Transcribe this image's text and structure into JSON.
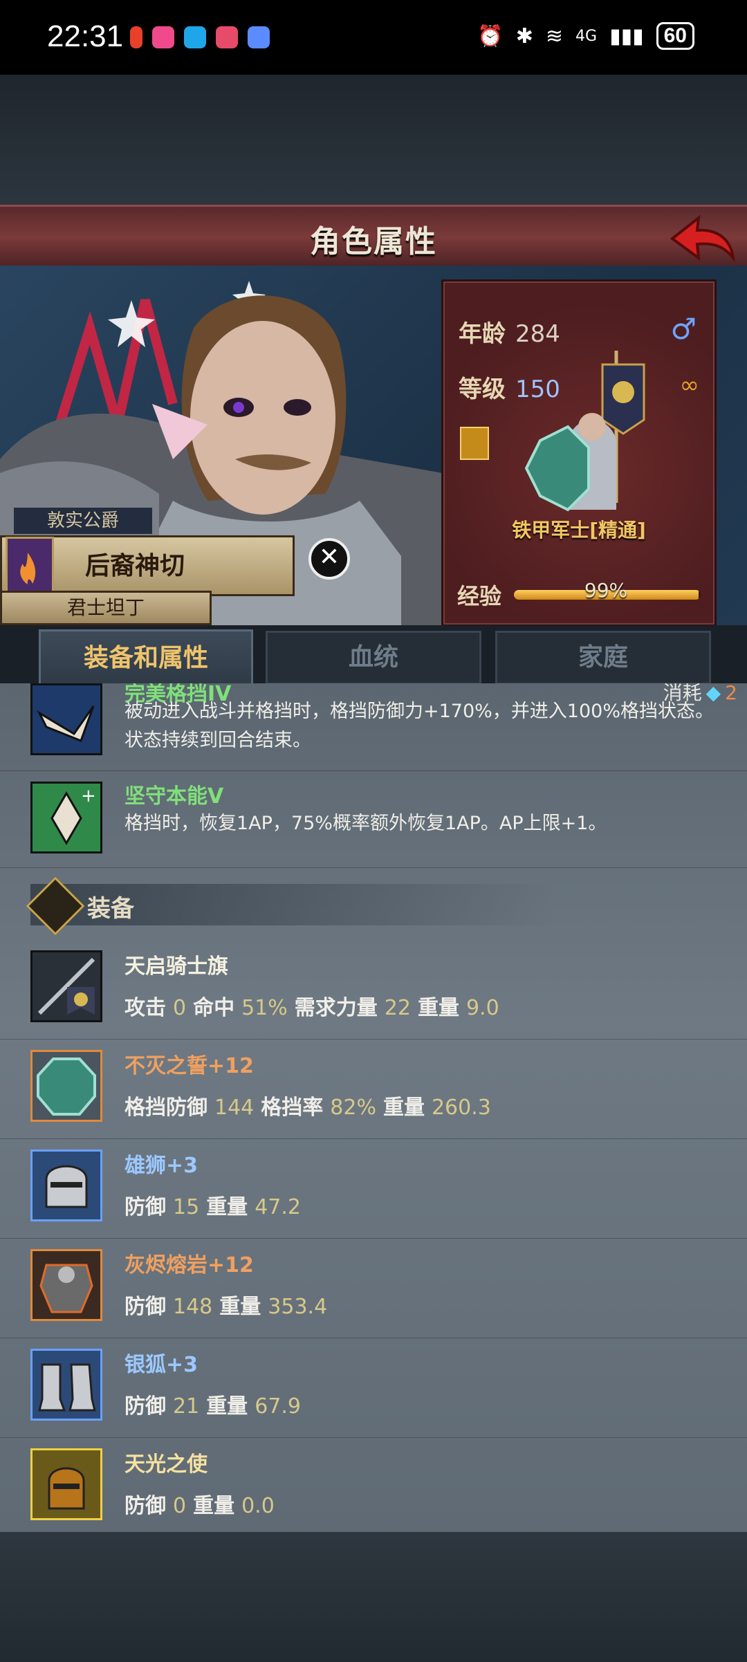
{
  "status_bar": {
    "time": "22:31",
    "battery": "60",
    "network": "4G"
  },
  "header": {
    "title": "角色属性"
  },
  "character": {
    "title": "敦实公爵",
    "name": "后裔神切",
    "subtitle": "君士坦丁",
    "age_label": "年龄",
    "age": "284",
    "level_label": "等级",
    "level": "150",
    "class_name": "铁甲军士[精通]",
    "exp_label": "经验",
    "exp_pct": "99%",
    "exp_fraction": 0.99
  },
  "tabs": [
    {
      "label": "装备和属性",
      "active": true
    },
    {
      "label": "血统",
      "active": false
    },
    {
      "label": "家庭",
      "active": false
    }
  ],
  "skills": [
    {
      "name": "完美格挡IV",
      "cost_label": "消耗",
      "cost": "2",
      "desc": "被动进入战斗并格挡时，格挡防御力+170%，并进入100%格挡状态。状态持续到回合结束。"
    },
    {
      "name": "坚守本能V",
      "desc": "格挡时，恢复1AP，75%概率额外恢复1AP。AP上限+1。"
    }
  ],
  "equipment_section": {
    "label": "装备"
  },
  "equipment": [
    {
      "name": "天启骑士旗",
      "stats": [
        {
          "label": "攻击",
          "value": "0"
        },
        {
          "label": "命中",
          "value": "51%"
        },
        {
          "label": "需求力量",
          "value": "22"
        },
        {
          "label": "重量",
          "value": "9.0"
        }
      ]
    },
    {
      "name": "不灭之誓+12",
      "stats": [
        {
          "label": "格挡防御",
          "value": "144"
        },
        {
          "label": "格挡率",
          "value": "82%"
        },
        {
          "label": "重量",
          "value": "260.3"
        }
      ]
    },
    {
      "name": "雄狮+3",
      "stats": [
        {
          "label": "防御",
          "value": "15"
        },
        {
          "label": "重量",
          "value": "47.2"
        }
      ]
    },
    {
      "name": "灰烬熔岩+12",
      "stats": [
        {
          "label": "防御",
          "value": "148"
        },
        {
          "label": "重量",
          "value": "353.4"
        }
      ]
    },
    {
      "name": "银狐+3",
      "stats": [
        {
          "label": "防御",
          "value": "21"
        },
        {
          "label": "重量",
          "value": "67.9"
        }
      ]
    },
    {
      "name": "天光之使",
      "stats": [
        {
          "label": "防御",
          "value": "0"
        },
        {
          "label": "重量",
          "value": "0.0"
        }
      ]
    }
  ]
}
